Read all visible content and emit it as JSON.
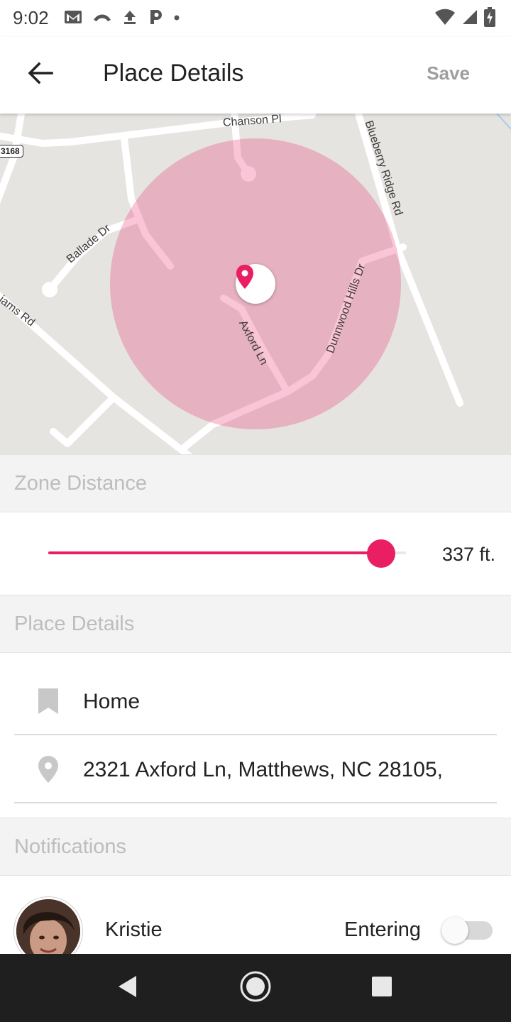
{
  "status_bar": {
    "time": "9:02",
    "left_icons": [
      "gmail-icon",
      "missed-call-icon",
      "upload-icon",
      "parking-icon",
      "dot-icon"
    ],
    "right_icons": [
      "wifi-icon",
      "cell-signal-icon",
      "battery-charging-icon"
    ]
  },
  "app_bar": {
    "title": "Place Details",
    "save_label": "Save"
  },
  "map": {
    "streets": [
      "Chanson Pl",
      "Blueberry Ridge Rd",
      "Ballade Dr",
      "Dunnwood Hills Dr",
      "Axford Ln",
      "iams Rd"
    ],
    "route_shield": "3168",
    "zone_color": "#e91e63"
  },
  "zone": {
    "header": "Zone Distance",
    "value_label": "337 ft.",
    "slider_fraction": 0.93
  },
  "place": {
    "header": "Place Details",
    "name": "Home",
    "address": "2321 Axford Ln, Matthews, NC 28105,"
  },
  "notifications": {
    "header": "Notifications",
    "items": [
      {
        "name": "Kristie",
        "status": "Entering",
        "enabled": false
      }
    ]
  },
  "colors": {
    "accent": "#e91e63",
    "section_header_bg": "#f3f3f3",
    "section_header_text": "#bdbdbd"
  }
}
